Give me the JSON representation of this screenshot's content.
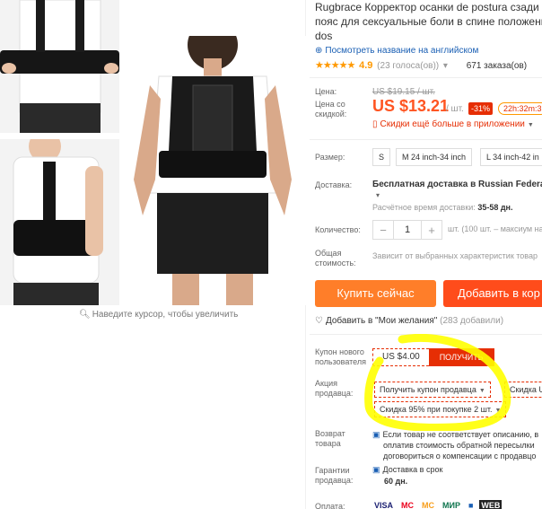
{
  "product": {
    "title_line1": "Rugbrace Корректор осанки de postura сзади no",
    "title_line2": "пояс для сексуальные боли в спине положения",
    "title_line3": "dos",
    "translate_link": "Посмотреть название на английском",
    "stars": "★★★★★",
    "rating": "4.9",
    "votes": "(23 голоса(ов))",
    "orders": "671 заказа(ов)"
  },
  "gallery": {
    "zoom_hint": "Наведите курсор, чтобы увеличить"
  },
  "price": {
    "label": "Цена:",
    "old": "US $19.15 / шт.",
    "discount_label": "Цена со скидкой:",
    "current": "US $13.21",
    "per": "/ шт.",
    "discount": "-31%",
    "timer": "22h:32m:3",
    "app_discount": "Скидки ещё больше в приложении"
  },
  "size": {
    "label": "Размер:",
    "options": [
      "S",
      "M 24 inch-34 inch",
      "L 34 inch-42 in"
    ]
  },
  "shipping": {
    "label": "Доставка:",
    "value": "Бесплатная доставка в Russian Federation",
    "time_label": "Расчётное время доставки:",
    "time_value": "35-58 дн."
  },
  "quantity": {
    "label": "Количество:",
    "minus": "−",
    "value": "1",
    "plus": "+",
    "note": "шт. (100 шт. – максиум на"
  },
  "total": {
    "label": "Общая стоимость:",
    "note": "Зависит от выбранных характеристик товар"
  },
  "actions": {
    "buy_now": "Купить сейчас",
    "add_to_cart": "Добавить в кор",
    "wishlist": "Добавить в \"Мои желания\"",
    "wishlist_count": "(283 добавили)"
  },
  "coupons": {
    "new_user_label": "Купон нового пользователя",
    "new_user_value": "US $4.00",
    "get_button": "ПОЛУЧИТЬ",
    "seller_label": "Акция продавца:",
    "seller_coupon": "Получить купон продавца",
    "seller_coupon2": "Скидка U",
    "bulk_discount": "Скидка 95% при покупке 2 шт."
  },
  "returns": {
    "label": "Возврат товара",
    "line1": "Если товар не соответствует описанию, в",
    "line2": "оплатив стоимость обратной пересылки",
    "line3": "договориться о компенсации с продавцо"
  },
  "guarantee": {
    "label": "Гарантии продавца:",
    "value": "Доставка в срок",
    "days": "60 дн."
  },
  "payment": {
    "label": "Оплата:",
    "methods": [
      "VISA",
      "MC",
      "MC",
      "МИР",
      "■",
      "WEB"
    ]
  },
  "colors": {
    "accent": "#ff4c1b",
    "price": "#f52",
    "highlight": "#ffff00"
  }
}
